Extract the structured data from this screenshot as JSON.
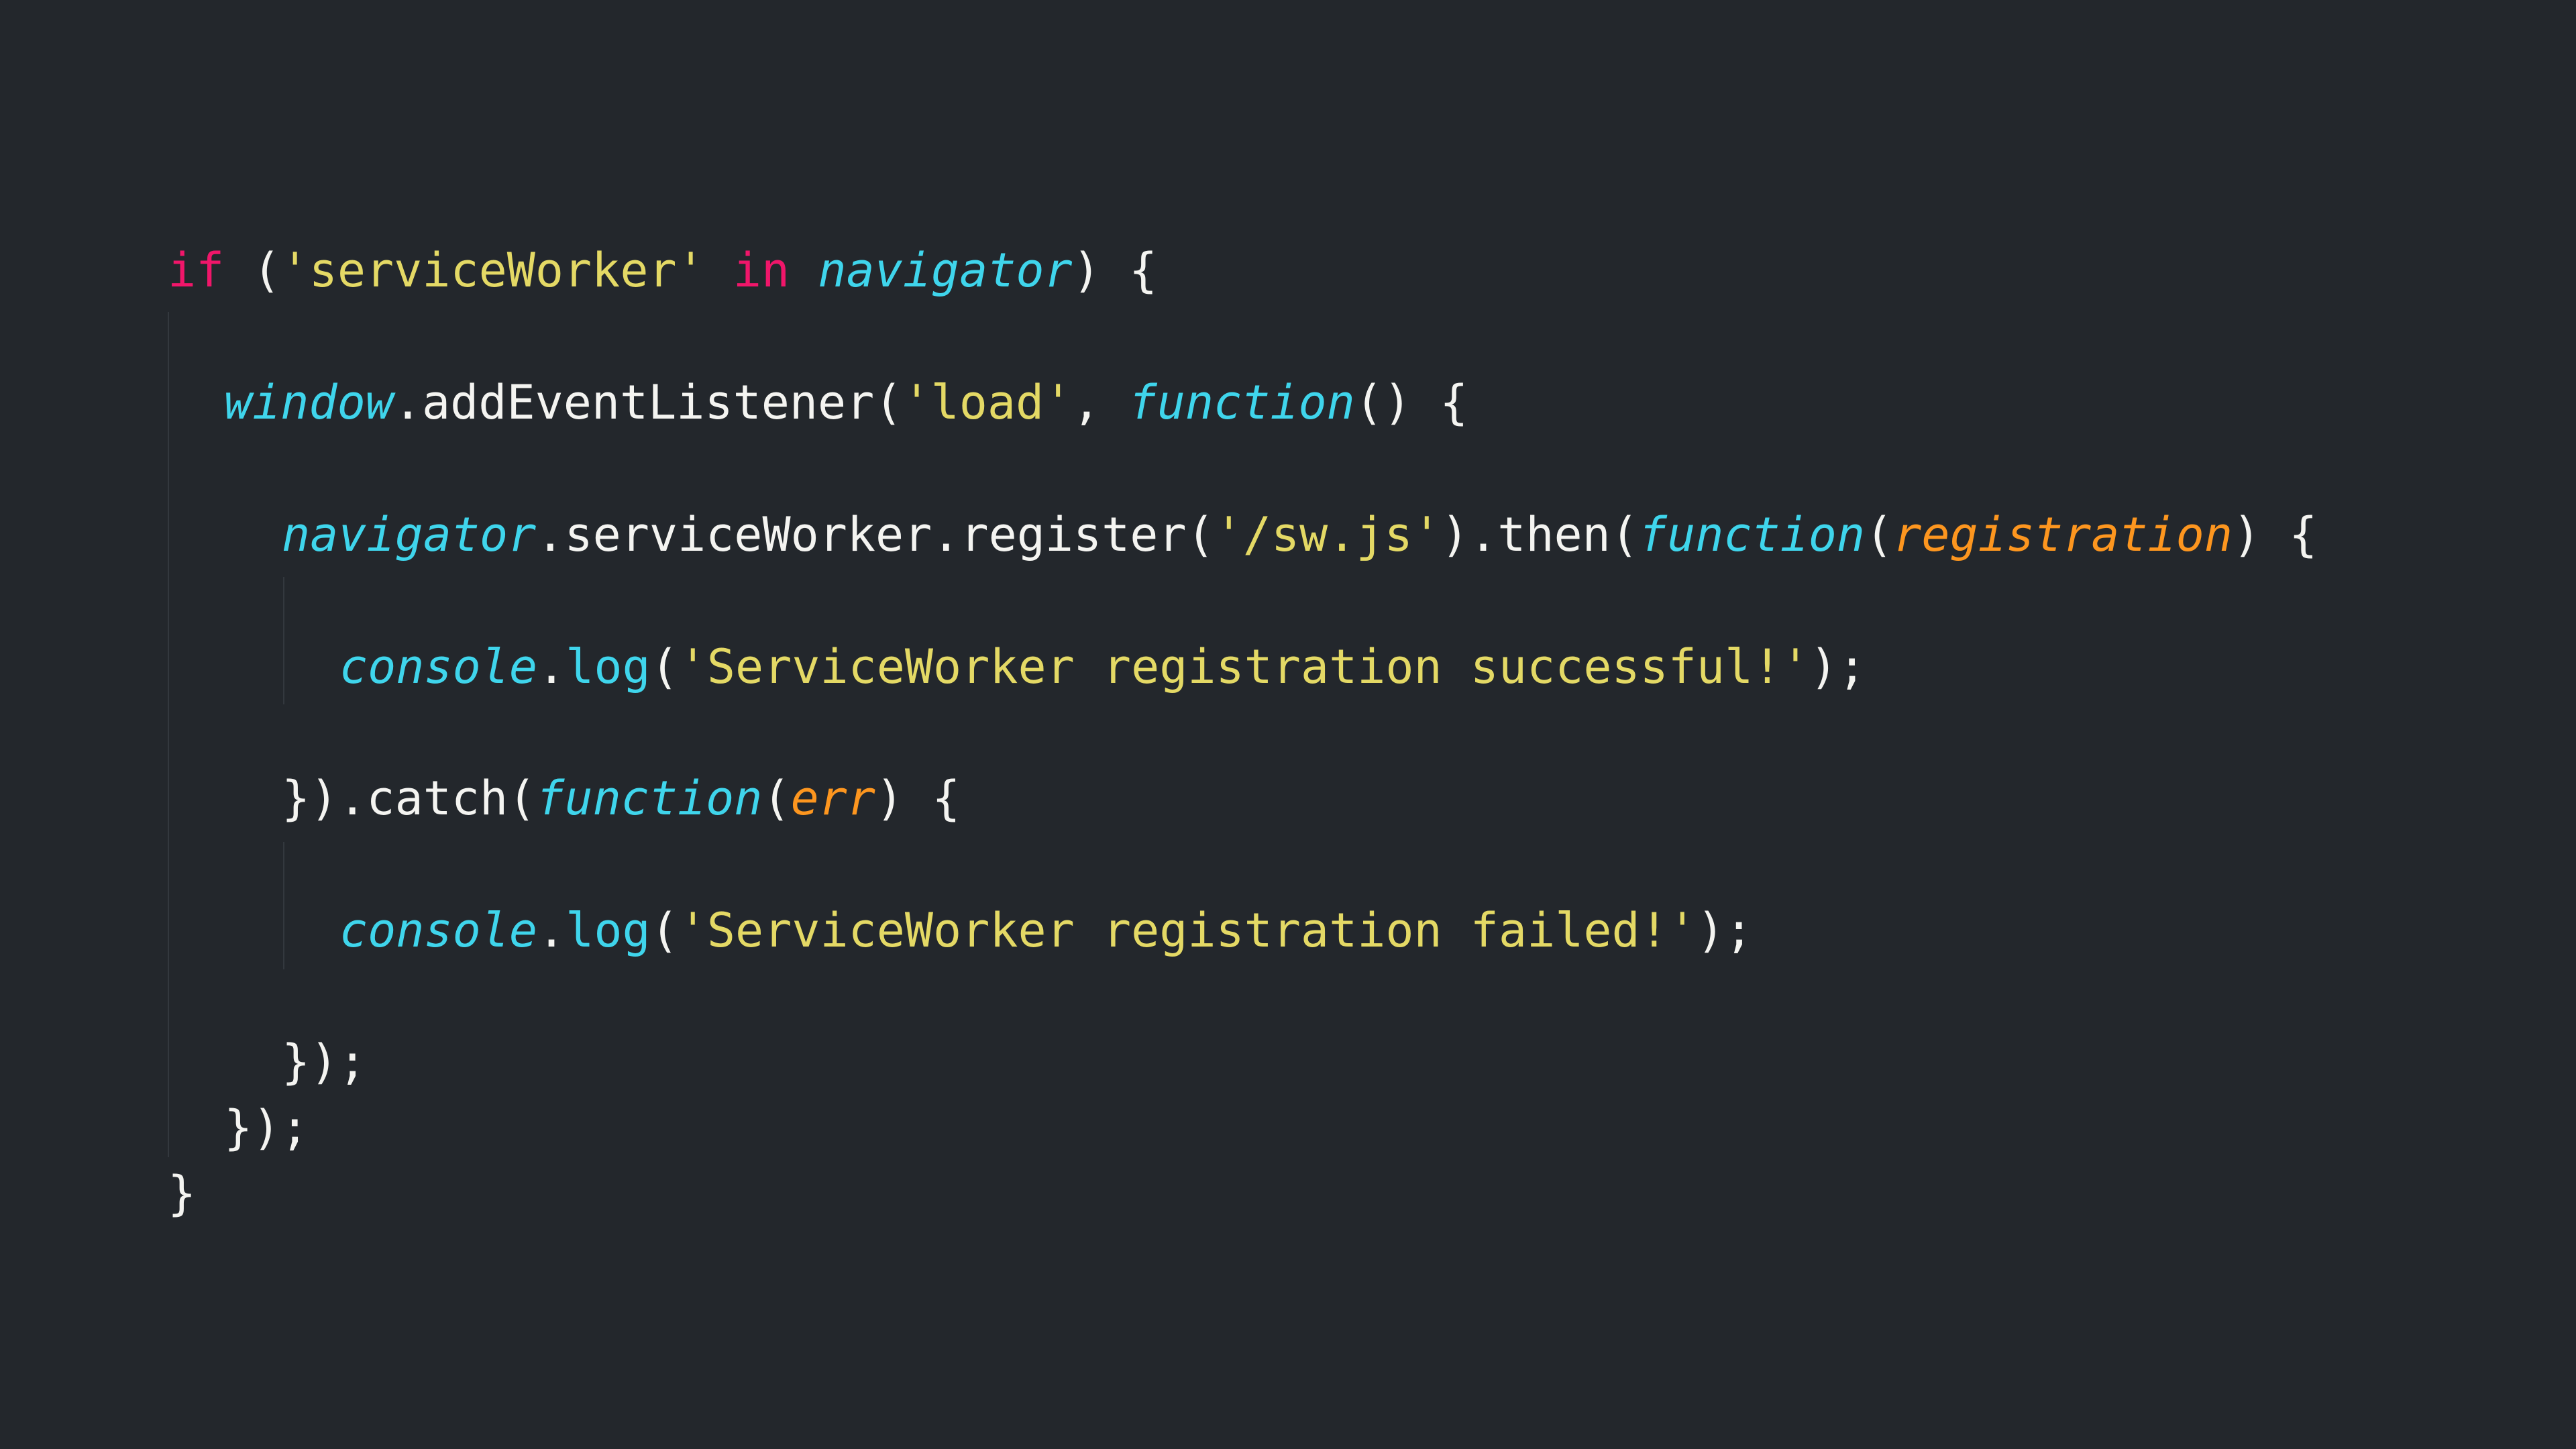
{
  "code": {
    "line1": {
      "t1": "if",
      "t2": " (",
      "t3": "'serviceWorker'",
      "t4": " ",
      "t5": "in",
      "t6": " ",
      "t7": "navigator",
      "t8": ") {"
    },
    "line2": {
      "t1": "window",
      "t2": ".addEventListener(",
      "t3": "'load'",
      "t4": ", ",
      "t5": "function",
      "t6": "() {"
    },
    "line3": {
      "t1": "navigator",
      "t2": ".serviceWorker.register(",
      "t3": "'/sw.js'",
      "t4": ").then(",
      "t5": "function",
      "t6": "(",
      "t7": "registration",
      "t8": ") {"
    },
    "line4": {
      "t1": "console",
      "t2": ".",
      "t3": "log",
      "t4": "(",
      "t5": "'ServiceWorker registration successful!'",
      "t6": ");"
    },
    "line5": {
      "t1": "}).catch(",
      "t2": "function",
      "t3": "(",
      "t4": "err",
      "t5": ") {"
    },
    "line6": {
      "t1": "console",
      "t2": ".",
      "t3": "log",
      "t4": "(",
      "t5": "'ServiceWorker registration failed!'",
      "t6": ");"
    },
    "line7": {
      "t1": "});"
    },
    "line8": {
      "t1": "});"
    },
    "line9": {
      "t1": "}"
    }
  },
  "colors": {
    "background": "#23272c",
    "keyword": "#f0166a",
    "string": "#e4d965",
    "builtin": "#3fd5ec",
    "parameter": "#fd961f",
    "plain": "#f4f4f1"
  }
}
